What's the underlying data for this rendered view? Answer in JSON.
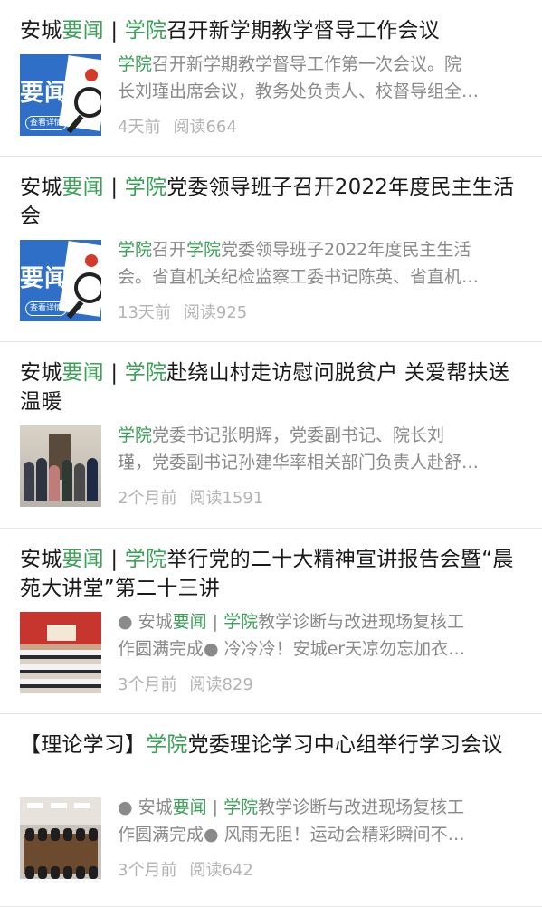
{
  "articles": [
    {
      "title_parts": [
        {
          "text": "安城",
          "green": false
        },
        {
          "text": "要闻",
          "green": true
        },
        {
          "text": " | ",
          "green": false
        },
        {
          "text": "学院",
          "green": true
        },
        {
          "text": "召开新学期教学督导工作会议",
          "green": false
        }
      ],
      "thumb_type": "news",
      "summary_line1": [
        {
          "text": "学院",
          "green": true
        },
        {
          "text": "召开新学期教学督导工作第一次会议。院",
          "green": false
        }
      ],
      "summary_line2": [
        {
          "text": "长刘瑾出席会议，教务处负责人、校督导组全…",
          "green": false
        }
      ],
      "time": "4天前",
      "reads": "阅读664"
    },
    {
      "title_parts": [
        {
          "text": "安城",
          "green": false
        },
        {
          "text": "要闻",
          "green": true
        },
        {
          "text": " | ",
          "green": false
        },
        {
          "text": "学院",
          "green": true
        },
        {
          "text": "党委领导班子召开2022年度民主生活会",
          "green": false
        }
      ],
      "thumb_type": "news",
      "summary_line1": [
        {
          "text": "学院",
          "green": true
        },
        {
          "text": "召开",
          "green": false
        },
        {
          "text": "学院",
          "green": true
        },
        {
          "text": "党委领导班子2022年度民主生活",
          "green": false
        }
      ],
      "summary_line2": [
        {
          "text": "会。省直机关纪检监察工委书记陈英、省直机…",
          "green": false
        }
      ],
      "time": "13天前",
      "reads": "阅读925"
    },
    {
      "title_parts": [
        {
          "text": "安城",
          "green": false
        },
        {
          "text": "要闻",
          "green": true
        },
        {
          "text": " | ",
          "green": false
        },
        {
          "text": "学院",
          "green": true
        },
        {
          "text": "赴绕山村走访慰问脱贫户 关爱帮扶送温暖",
          "green": false
        }
      ],
      "thumb_type": "photo1",
      "summary_line1": [
        {
          "text": "学院",
          "green": true
        },
        {
          "text": "党委书记张明辉，党委副书记、院长刘",
          "green": false
        }
      ],
      "summary_line2": [
        {
          "text": "瑾，党委副书记孙建华率相关部门负责人赴舒…",
          "green": false
        }
      ],
      "time": "2个月前",
      "reads": "阅读1591"
    },
    {
      "title_parts": [
        {
          "text": "安城",
          "green": false
        },
        {
          "text": "要闻",
          "green": true
        },
        {
          "text": " | ",
          "green": false
        },
        {
          "text": "学院",
          "green": true
        },
        {
          "text": "举行党的二十大精神宣讲报告会暨“晨苑大讲堂”第二十三讲",
          "green": false
        }
      ],
      "thumb_type": "photo2",
      "summary_line1": [
        {
          "text": "● 安城",
          "green": false
        },
        {
          "text": "要闻",
          "green": true
        },
        {
          "text": " | ",
          "green": false
        },
        {
          "text": "学院",
          "green": true
        },
        {
          "text": "教学诊断与改进现场复核工",
          "green": false
        }
      ],
      "summary_line2": [
        {
          "text": "作圆满完成● 冷冷冷！安城er天凉勿忘加衣…",
          "green": false
        }
      ],
      "time": "3个月前",
      "reads": "阅读829"
    },
    {
      "title_parts": [
        {
          "text": "【理论学习】",
          "green": false
        },
        {
          "text": "学院",
          "green": true
        },
        {
          "text": "党委理论学习中心组举行学习会议",
          "green": false
        }
      ],
      "thumb_type": "photo3",
      "summary_line1": [
        {
          "text": "● 安城",
          "green": false
        },
        {
          "text": "要闻",
          "green": true
        },
        {
          "text": " | ",
          "green": false
        },
        {
          "text": "学院",
          "green": true
        },
        {
          "text": "教学诊断与改进现场复核工",
          "green": false
        }
      ],
      "summary_line2": [
        {
          "text": "作圆满完成● 风雨无阻！运动会精彩瞬间不…",
          "green": false
        }
      ],
      "time": "3个月前",
      "reads": "阅读642"
    }
  ],
  "thumb_text": {
    "word": "要闻",
    "pill": "查看详情"
  },
  "colors": {
    "accent": "#3aa157",
    "text": "#1a1a1a",
    "muted": "#8a8a8a",
    "meta": "#b3b3b3"
  }
}
